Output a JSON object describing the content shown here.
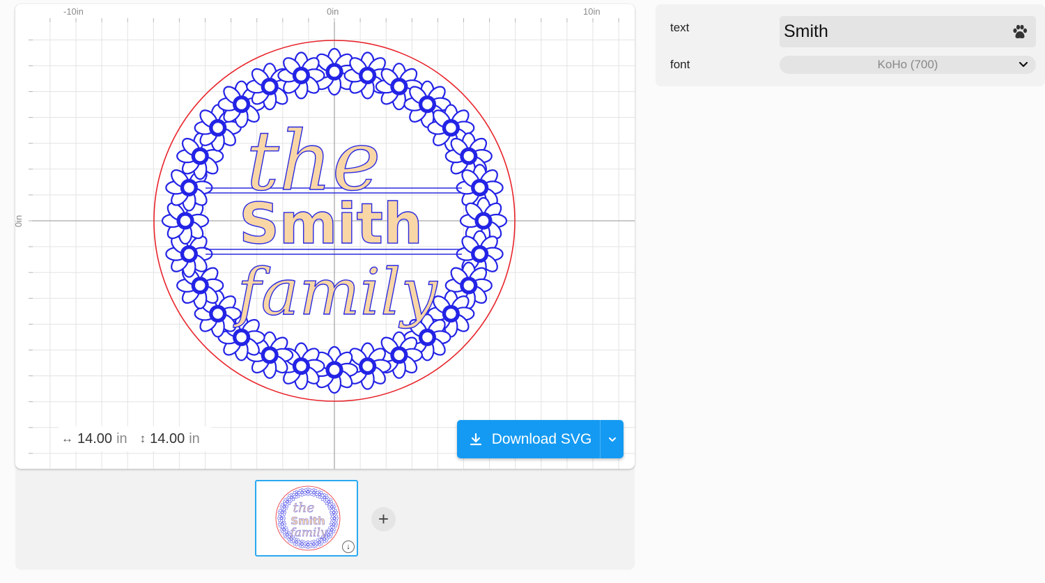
{
  "rulers": {
    "x_labels": [
      "-10in",
      "0in",
      "10in"
    ],
    "y_label": "0in"
  },
  "design": {
    "line1": "the",
    "line2": "Smith",
    "line3": "family",
    "colors": {
      "cut_outline": "#e8232a",
      "flowers": "#2323e6",
      "text_fill": "#f9d6a6",
      "text_stroke": "#2a2ae0"
    }
  },
  "dimensions": {
    "width_value": "14.00",
    "height_value": "14.00",
    "unit": "in",
    "width_icon": "horizontal-arrows-icon",
    "height_icon": "vertical-arrows-icon"
  },
  "download": {
    "label": "Download SVG",
    "icon": "download-icon",
    "menu_icon": "chevron-down-icon",
    "color": "#149af2"
  },
  "thumbnail": {
    "line1": "the",
    "line2": "Smith",
    "line3": "family",
    "badge_icon": "download-badge-icon"
  },
  "add_button": {
    "label": "+"
  },
  "properties": {
    "text_label": "text",
    "text_value": "Smith",
    "text_icon": "paw-icon",
    "font_label": "font",
    "font_value": "KoHo (700)"
  }
}
